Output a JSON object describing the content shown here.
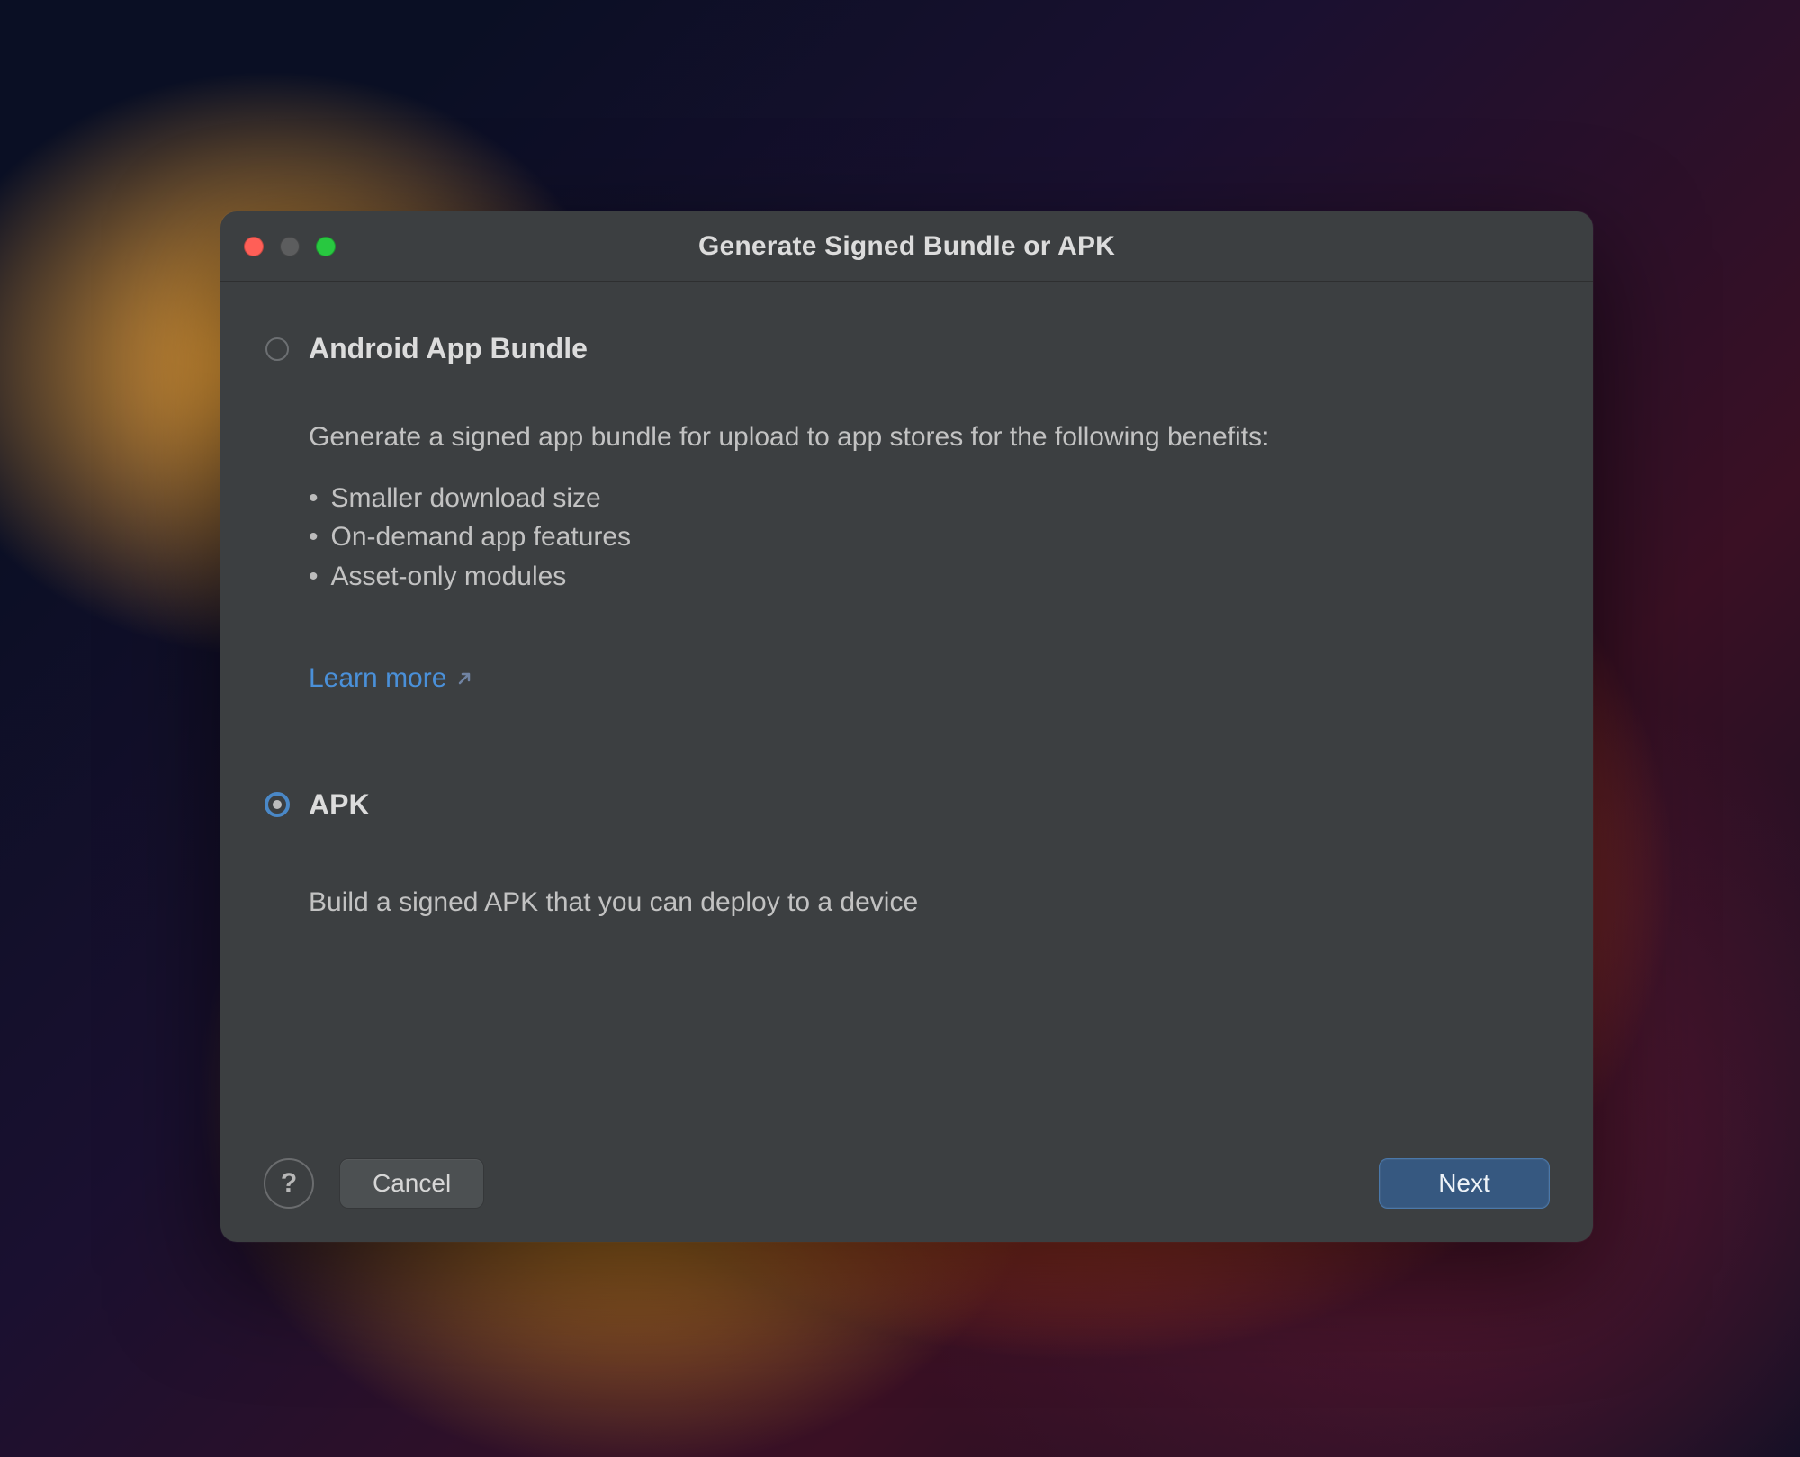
{
  "window": {
    "title": "Generate Signed Bundle or APK"
  },
  "options": {
    "bundle": {
      "label": "Android App Bundle",
      "selected": false,
      "description": "Generate a signed app bundle for upload to app stores for the following benefits:",
      "bullets": [
        "Smaller download size",
        "On-demand app features",
        "Asset-only modules"
      ],
      "learn_more": "Learn more"
    },
    "apk": {
      "label": "APK",
      "selected": true,
      "description": "Build a signed APK that you can deploy to a device"
    }
  },
  "buttons": {
    "help": "?",
    "cancel": "Cancel",
    "next": "Next"
  },
  "icons": {
    "external_link": "external-link-icon"
  }
}
